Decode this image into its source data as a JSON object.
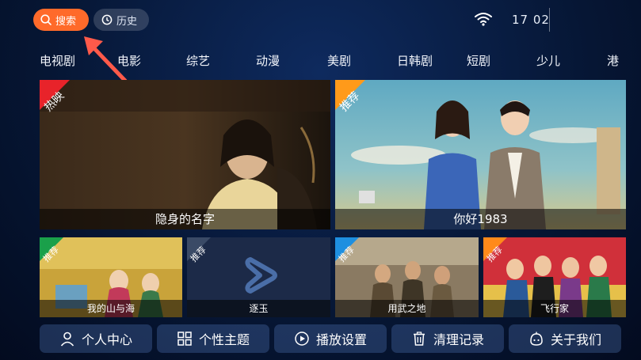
{
  "topbar": {
    "search_label": "搜索",
    "history_label": "历史",
    "time": "17 02"
  },
  "categories": [
    "电视剧",
    "电影",
    "综艺",
    "动漫",
    "美剧",
    "日韩剧",
    "短剧",
    "少儿",
    "港"
  ],
  "featured": [
    {
      "title": "隐身的名字",
      "badge": "热映",
      "badge_color": "#e8232a"
    },
    {
      "title": "你好1983",
      "badge": "推荐",
      "badge_color": "#ff9a1a"
    }
  ],
  "tiles": [
    {
      "title": "我的山与海",
      "badge": "推荐",
      "badge_color": "#1aa04a"
    },
    {
      "title": "逐玉",
      "badge": "推荐",
      "badge_color": "#3a4a66"
    },
    {
      "title": "用武之地",
      "badge": "推荐",
      "badge_color": "#1e8fe0"
    },
    {
      "title": "飞行家",
      "badge": "推荐",
      "badge_color": "#ff8a1a"
    }
  ],
  "bottom_buttons": [
    {
      "label": "个人中心",
      "icon": "user-icon"
    },
    {
      "label": "个性主题",
      "icon": "grid-icon"
    },
    {
      "label": "播放设置",
      "icon": "play-circle-icon"
    },
    {
      "label": "清理记录",
      "icon": "trash-icon"
    },
    {
      "label": "关于我们",
      "icon": "info-icon"
    }
  ],
  "colors": {
    "accent": "#ff6a2a",
    "pointer_arrow": "#ff5a4a"
  }
}
